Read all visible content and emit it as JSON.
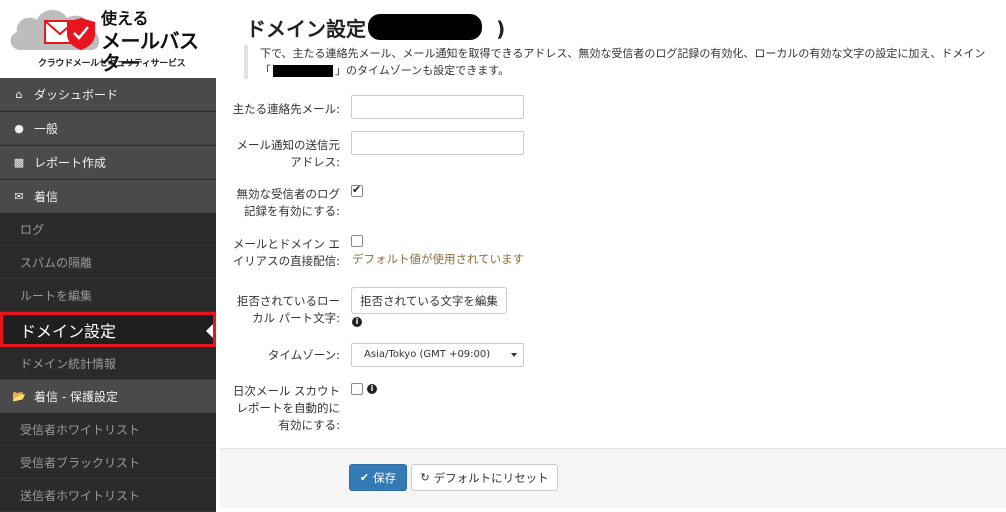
{
  "brand": {
    "line1": "使える",
    "line2": "メールバスター",
    "subtitle": "クラウドメールセキュリティサービス",
    "colors": {
      "accent": "#e8141e",
      "cloud": "#b8b8b8"
    }
  },
  "sidebar": {
    "items": [
      {
        "label": "ダッシュボード",
        "icon": "home-icon",
        "type": "top"
      },
      {
        "label": "一般",
        "icon": "globe-icon",
        "type": "top"
      },
      {
        "label": "レポート作成",
        "icon": "report-icon",
        "type": "top"
      },
      {
        "label": "着信",
        "icon": "envelope-icon",
        "type": "top"
      },
      {
        "label": "ログ",
        "type": "sub"
      },
      {
        "label": "スパムの隔離",
        "type": "sub"
      },
      {
        "label": "ルートを編集",
        "type": "sub"
      },
      {
        "label": "ドメイン設定",
        "type": "sub",
        "active": true
      },
      {
        "label": "ドメイン統計情報",
        "type": "sub"
      },
      {
        "label": "着信 - 保護設定",
        "icon": "folder-open-icon",
        "type": "top"
      },
      {
        "label": "受信者ホワイトリスト",
        "type": "sub"
      },
      {
        "label": "受信者ブラックリスト",
        "type": "sub"
      },
      {
        "label": "送信者ホワイトリスト",
        "type": "sub"
      }
    ]
  },
  "main": {
    "title": "ドメイン設定 (",
    "title_close": ")",
    "description_part1": "下で、主たる連絡先メール、メール通知を取得できるアドレス、無効な受信者のログ記録の有効化、ローカルの有効な文字の設定に加え、ドメイン「",
    "description_part2": "」のタイムゾーンも設定できます。",
    "fields": {
      "primary_contact_label": "主たる連絡先メール:",
      "primary_contact_value": "",
      "notify_sender_label": "メール通知の送信元アドレス:",
      "notify_sender_value": "",
      "invalid_log_label": "無効な受信者のログ記録を有効にする:",
      "invalid_log_checked": true,
      "alias_label": "メールとドメイン エイリアスの直接配信:",
      "alias_checked": false,
      "alias_hint": "デフォルト値が使用されています",
      "rejected_chars_label": "拒否されているローカル パート文字:",
      "rejected_chars_button": "拒否されている文字を編集",
      "timezone_label": "タイムゾーン:",
      "timezone_value": "Asia/Tokyo (GMT +09:00)",
      "daily_scout_label": "日次メール スカウト レポートを自動的に有効にする:",
      "daily_scout_checked": false
    },
    "buttons": {
      "save": "保存",
      "reset": "デフォルトにリセット"
    },
    "colors": {
      "primary_button": "#337ab7",
      "hint": "#8a6d3b"
    }
  }
}
